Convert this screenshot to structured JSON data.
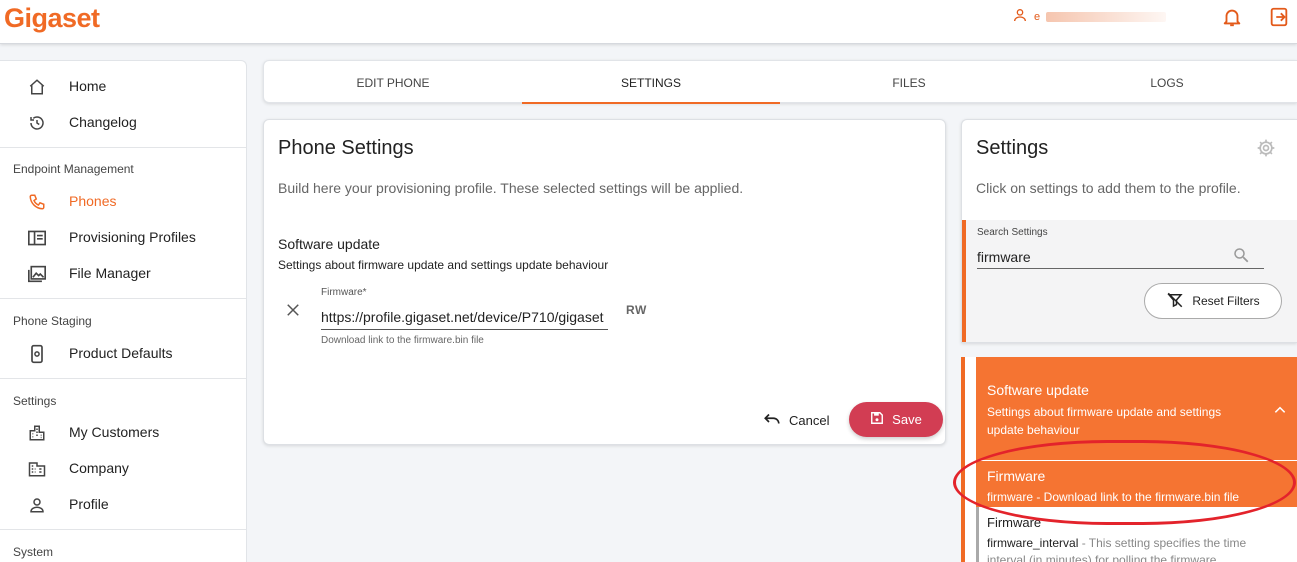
{
  "brand": {
    "logo": "Gigaset",
    "accent": "#f06a25",
    "save_color": "#d23d53",
    "highlight": "#e3232b"
  },
  "header": {
    "user_name": "e",
    "icons": [
      "person-icon",
      "bell-icon",
      "logout-icon"
    ]
  },
  "sidebar": {
    "items_top": [
      {
        "label": "Home",
        "icon": "home-icon"
      },
      {
        "label": "Changelog",
        "icon": "history-icon"
      }
    ],
    "endpoint_title": "Endpoint Management",
    "endpoint_items": [
      {
        "label": "Phones",
        "icon": "phone-icon",
        "active": true
      },
      {
        "label": "Provisioning Profiles",
        "icon": "profile-icon"
      },
      {
        "label": "File Manager",
        "icon": "image-icon"
      }
    ],
    "staging_title": "Phone Staging",
    "staging_items": [
      {
        "label": "Product Defaults",
        "icon": "device-settings-icon"
      }
    ],
    "settings_title": "Settings",
    "settings_items": [
      {
        "label": "My Customers",
        "icon": "city-icon"
      },
      {
        "label": "Company",
        "icon": "building-icon"
      },
      {
        "label": "Profile",
        "icon": "person-icon"
      }
    ],
    "system_title": "System"
  },
  "tabs": [
    {
      "label": "EDIT PHONE"
    },
    {
      "label": "SETTINGS",
      "active": true
    },
    {
      "label": "FILES"
    },
    {
      "label": "LOGS"
    }
  ],
  "phone_settings": {
    "title": "Phone Settings",
    "description": "Build here your provisioning profile. These selected settings will be applied.",
    "group_title": "Software update",
    "group_description": "Settings about firmware update and settings update behaviour",
    "field": {
      "label": "Firmware*",
      "value": "https://profile.gigaset.net/device/P710/gigaset",
      "hint": "Download link to the firmware.bin file",
      "access": "RW"
    },
    "cancel_label": "Cancel",
    "save_label": "Save"
  },
  "settings_panel": {
    "title": "Settings",
    "description": "Click on settings to add them to the profile.",
    "search": {
      "label": "Search Settings",
      "value": "firmware"
    },
    "reset_label": "Reset Filters",
    "group": {
      "title": "Software update",
      "description": "Settings about firmware update and settings update behaviour"
    },
    "selected_result": {
      "title": "Firmware",
      "description": "firmware - Download link to the firmware.bin file"
    },
    "next_result": {
      "title": "Firmware",
      "key": "firmware_interval",
      "description": " - This setting specifies the time interval (in minutes) for polling the firmware"
    }
  }
}
